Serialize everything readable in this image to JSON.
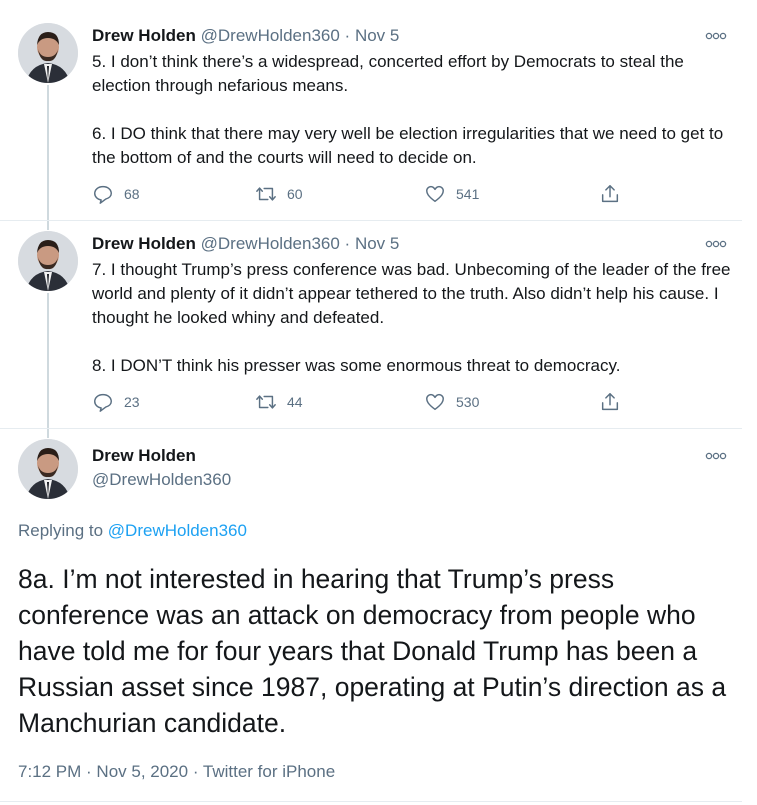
{
  "tweets": [
    {
      "name": "Drew Holden",
      "handle": "@DrewHolden360",
      "date": "Nov 5",
      "paragraphs": [
        "5. I don’t think there’s a widespread, concerted effort by Democrats to steal the election through nefarious means.",
        "6. I DO think that there may very well be election irregularities that we need to get to the bottom of and the courts will need to decide on."
      ],
      "replies": "68",
      "retweets": "60",
      "likes": "541"
    },
    {
      "name": "Drew Holden",
      "handle": "@DrewHolden360",
      "date": "Nov 5",
      "paragraphs": [
        "7. I thought Trump’s press conference was bad. Unbecoming of the leader of the free world and plenty of it didn’t appear tethered to the truth. Also didn’t help his cause. I thought he looked whiny and defeated.",
        "8. I DON’T think his presser was some enormous threat to democracy."
      ],
      "replies": "23",
      "retweets": "44",
      "likes": "530"
    }
  ],
  "main_tweet": {
    "name": "Drew Holden",
    "handle": "@DrewHolden360",
    "replying_label": "Replying to",
    "replying_to": "@DrewHolden360",
    "text": "8a. I’m not interested in hearing that Trump’s press conference was an attack on democracy from people who have told me for four years that Donald Trump has been a Russian asset since 1987, operating at Putin’s direction as a Manchurian candidate.",
    "footer": "7:12 PM · Nov 5, 2020 · Twitter for iPhone"
  },
  "icons": [
    "avatar",
    "more-icon",
    "reply-icon",
    "retweet-icon",
    "like-icon",
    "share-icon"
  ],
  "colors": {
    "text": "#14171a",
    "secondary": "#5b7083",
    "link": "#1da1f2",
    "divider": "#e6ecf0",
    "thread": "#cfd9de"
  }
}
